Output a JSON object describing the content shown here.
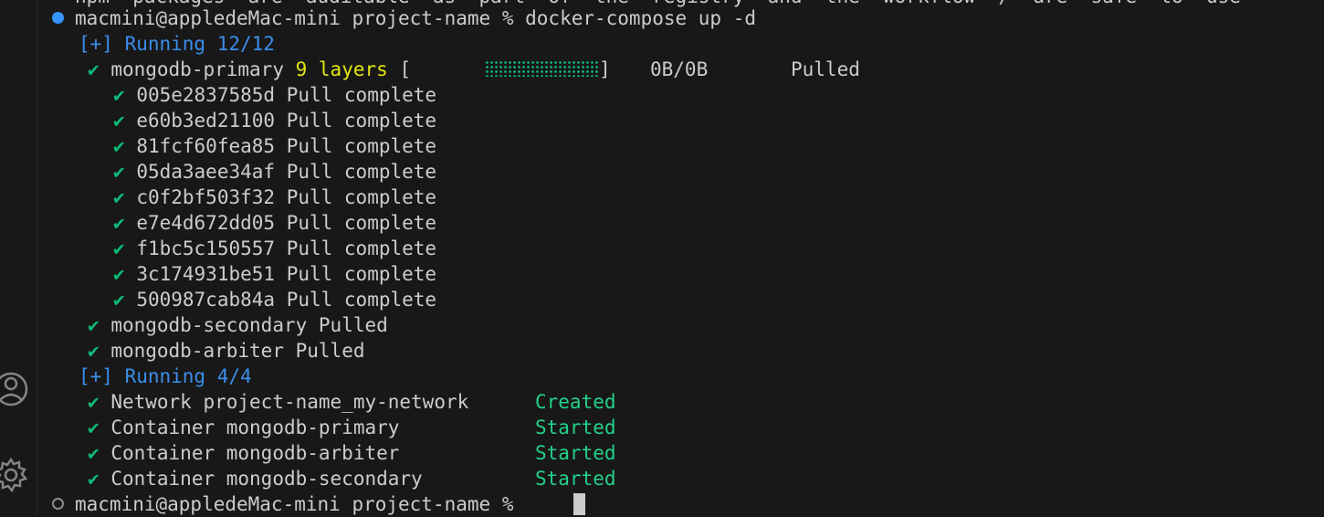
{
  "prompt": {
    "user_host": "macmini@appledeMac-mini",
    "dir": "project-name",
    "symbol": "%",
    "command": "docker-compose up -d"
  },
  "cut_top_text": "npm  packages  are  auditable  as  part  of  the  registry  and  the  workflow  /  are  safe  to  use",
  "running1": "[+] Running 12/12",
  "primary": {
    "check": "✔",
    "name": "mongodb-primary",
    "layers": "9 layers",
    "bracket_open": "[",
    "bracket_close": "]",
    "size": "0B/0B",
    "status": "Pulled"
  },
  "layers": [
    {
      "id": "005e2837585d",
      "status": "Pull complete"
    },
    {
      "id": "e60b3ed21100",
      "status": "Pull complete"
    },
    {
      "id": "81fcf60fea85",
      "status": "Pull complete"
    },
    {
      "id": "05da3aee34af",
      "status": "Pull complete"
    },
    {
      "id": "c0f2bf503f32",
      "status": "Pull complete"
    },
    {
      "id": "e7e4d672dd05",
      "status": "Pull complete"
    },
    {
      "id": "f1bc5c150557",
      "status": "Pull complete"
    },
    {
      "id": "3c174931be51",
      "status": "Pull complete"
    },
    {
      "id": "500987cab84a",
      "status": "Pull complete"
    }
  ],
  "pulled": [
    {
      "name": "mongodb-secondary",
      "status": "Pulled"
    },
    {
      "name": "mongodb-arbiter",
      "status": "Pulled"
    }
  ],
  "running2": "[+] Running 4/4",
  "resources": [
    {
      "name": "Network project-name_my-network",
      "status": "Created"
    },
    {
      "name": "Container mongodb-primary",
      "status": "Started"
    },
    {
      "name": "Container mongodb-arbiter",
      "status": "Started"
    },
    {
      "name": "Container mongodb-secondary",
      "status": "Started"
    }
  ],
  "check": "✔",
  "icons": {
    "account": "account-icon",
    "settings": "gear-icon"
  },
  "colors": {
    "background": "#181818",
    "text": "#cccccc",
    "blue": "#3b8eea",
    "green": "#23d18b",
    "yellow": "#e5e510"
  }
}
